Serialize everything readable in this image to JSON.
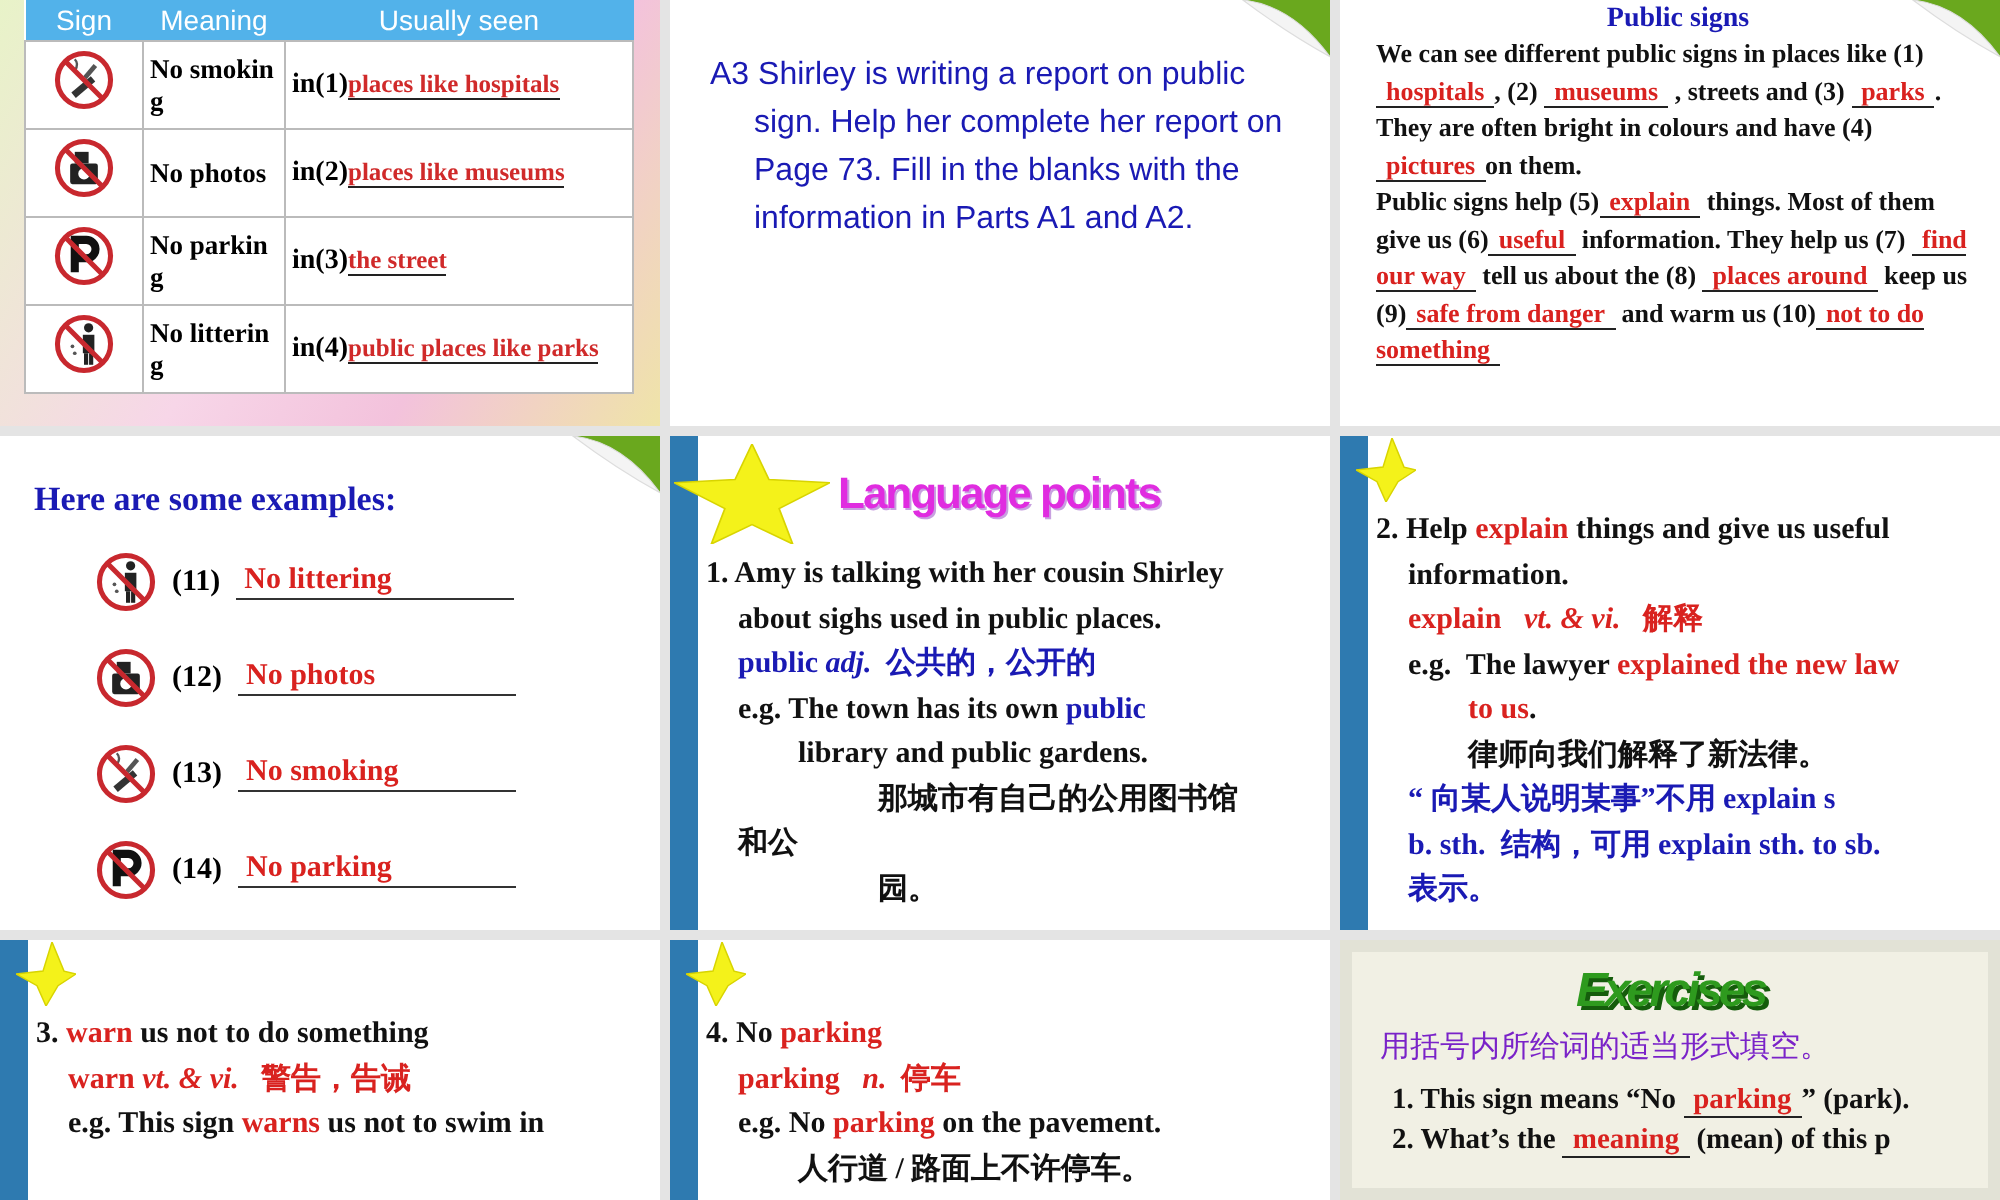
{
  "slides": [
    {
      "kind": "sign-table",
      "columns": [
        "Sign",
        "Meaning",
        "Usually seen"
      ],
      "rows": [
        {
          "kind": "smoking",
          "meaning": "No smoking",
          "number": "in(1)",
          "answer": "places like hospitals"
        },
        {
          "kind": "camera",
          "meaning": "No photos",
          "number": "in(2)",
          "answer": "places like museums"
        },
        {
          "kind": "parking",
          "meaning": "No parking",
          "number": "in(3)",
          "answer": "the street"
        },
        {
          "kind": "litter",
          "meaning": "No littering",
          "number": "in(4)",
          "answer": "public places like parks"
        }
      ]
    },
    {
      "kind": "text",
      "paragraph": "A3 Shirley is writing a report on public sign. Help her complete her report on Page 73. Fill in the blanks with the information in Parts A1 and A2."
    },
    {
      "kind": "report",
      "title": "Public signs",
      "paragraphs": [
        [
          {
            "text": "We can see different public signs in places like (1) ",
            "kind": "plain"
          },
          {
            "text": "hospitals",
            "kind": "blank"
          },
          {
            "text": ", (2) ",
            "kind": "plain"
          },
          {
            "text": "museums",
            "kind": "blank"
          },
          {
            "text": " , streets and (3) ",
            "kind": "plain"
          },
          {
            "text": "parks",
            "kind": "blank"
          },
          {
            "text": ". They are often bright in colours and have (4) ",
            "kind": "plain"
          },
          {
            "text": "pictures",
            "kind": "blank"
          },
          {
            "text": "on them.",
            "kind": "plain"
          }
        ],
        [
          {
            "text": "Public signs help (5)",
            "kind": "plain"
          },
          {
            "text": "explain",
            "kind": "blank"
          },
          {
            "text": " things. Most of them give us (6)",
            "kind": "plain"
          },
          {
            "text": "useful",
            "kind": "blank"
          },
          {
            "text": " information. They help us (7) ",
            "kind": "plain"
          },
          {
            "text": "find our way",
            "kind": "blank"
          },
          {
            "text": " tell us about the (8) ",
            "kind": "plain"
          },
          {
            "text": "places around",
            "kind": "blank"
          },
          {
            "text": " keep us (9)",
            "kind": "plain"
          },
          {
            "text": "safe from danger",
            "kind": "blank"
          },
          {
            "text": " and warm us (10)",
            "kind": "plain"
          },
          {
            "text": "not to do something",
            "kind": "blank"
          }
        ]
      ]
    },
    {
      "kind": "examples",
      "title": "Here are some examples:",
      "items": [
        {
          "kind": "litter",
          "number": "(11)",
          "answer": "No littering"
        },
        {
          "kind": "camera",
          "number": "(12)",
          "answer": "No photos"
        },
        {
          "kind": "smoking",
          "number": "(13)",
          "answer": "No smoking"
        },
        {
          "kind": "parking",
          "number": "(14)",
          "answer": "No parking"
        }
      ]
    },
    {
      "kind": "notes",
      "title": "Language points",
      "lines": [
        {
          "kind": "head",
          "runs": [
            {
              "text": "1. Amy is talking with her cousin Shirley",
              "kind": "plain"
            }
          ]
        },
        {
          "kind": "body",
          "runs": [
            {
              "text": "about sighs used in public places.",
              "kind": "plain"
            }
          ]
        },
        {
          "kind": "body",
          "runs": [
            {
              "text": "public ",
              "kind": "blue"
            },
            {
              "text": "adj.",
              "kind": "blue-italic"
            },
            {
              "text": "  公共的，公开的",
              "kind": "blue"
            }
          ]
        },
        {
          "kind": "body",
          "runs": [
            {
              "text": "e.g. The town has its own ",
              "kind": "plain"
            },
            {
              "text": "public",
              "kind": "blue"
            }
          ]
        },
        {
          "kind": "sub",
          "runs": [
            {
              "text": "library and public gardens.",
              "kind": "plain"
            }
          ]
        },
        {
          "kind": "far",
          "runs": [
            {
              "text": "那城市有自己的公用图书馆",
              "kind": "plain"
            }
          ]
        },
        {
          "kind": "body",
          "runs": [
            {
              "text": "和公",
              "kind": "plain"
            }
          ]
        },
        {
          "kind": "far",
          "runs": [
            {
              "text": "园。",
              "kind": "plain"
            }
          ]
        }
      ]
    },
    {
      "kind": "notes",
      "lines": [
        {
          "kind": "head",
          "runs": [
            {
              "text": "2. Help ",
              "kind": "plain"
            },
            {
              "text": "explain",
              "kind": "red"
            },
            {
              "text": " things and give us useful",
              "kind": "plain"
            }
          ]
        },
        {
          "kind": "body",
          "runs": [
            {
              "text": "information.",
              "kind": "plain"
            }
          ]
        },
        {
          "kind": "body",
          "runs": [
            {
              "text": "explain   ",
              "kind": "red"
            },
            {
              "text": "vt. & vi.",
              "kind": "red-italic"
            },
            {
              "text": "   解释",
              "kind": "red"
            }
          ]
        },
        {
          "kind": "body",
          "runs": [
            {
              "text": "e.g.  The lawyer ",
              "kind": "plain"
            },
            {
              "text": "explained the new law",
              "kind": "red"
            }
          ]
        },
        {
          "kind": "sub",
          "runs": [
            {
              "text": "to us",
              "kind": "red"
            },
            {
              "text": ".",
              "kind": "plain"
            }
          ]
        },
        {
          "kind": "sub",
          "runs": [
            {
              "text": "律师向我们解释了新法律。",
              "kind": "plain"
            }
          ]
        },
        {
          "kind": "body",
          "runs": [
            {
              "text": "“ 向某人说明某事”不用 explain s",
              "kind": "blue"
            }
          ]
        },
        {
          "kind": "body",
          "runs": [
            {
              "text": "b. sth.  结构，可用 explain sth. to sb.",
              "kind": "blue"
            }
          ]
        },
        {
          "kind": "body",
          "runs": [
            {
              "text": "表示。",
              "kind": "blue"
            }
          ]
        }
      ]
    },
    {
      "kind": "notes",
      "lines": [
        {
          "kind": "head",
          "runs": [
            {
              "text": "3. ",
              "kind": "plain"
            },
            {
              "text": "warn",
              "kind": "red"
            },
            {
              "text": " us not to do something",
              "kind": "plain"
            }
          ]
        },
        {
          "kind": "body",
          "runs": [
            {
              "text": "warn ",
              "kind": "red"
            },
            {
              "text": "vt. & vi.",
              "kind": "red-italic"
            },
            {
              "text": "   警告，告诫",
              "kind": "red"
            }
          ]
        },
        {
          "kind": "body",
          "runs": [
            {
              "text": "e.g. This sign ",
              "kind": "plain"
            },
            {
              "text": "warns",
              "kind": "red"
            },
            {
              "text": " us not to swim in",
              "kind": "plain"
            }
          ]
        }
      ]
    },
    {
      "kind": "notes",
      "lines": [
        {
          "kind": "head",
          "runs": [
            {
              "text": "4. No ",
              "kind": "plain"
            },
            {
              "text": "parking",
              "kind": "red"
            }
          ]
        },
        {
          "kind": "body",
          "runs": [
            {
              "text": "parking   ",
              "kind": "red"
            },
            {
              "text": "n.",
              "kind": "red-italic"
            },
            {
              "text": "  停车",
              "kind": "red"
            }
          ]
        },
        {
          "kind": "body",
          "runs": [
            {
              "text": "e.g. No ",
              "kind": "plain"
            },
            {
              "text": "parking",
              "kind": "red"
            },
            {
              "text": " on the pavement.",
              "kind": "plain"
            }
          ]
        },
        {
          "kind": "sub",
          "runs": [
            {
              "text": "人行道 / 路面上不许停车。",
              "kind": "plain"
            }
          ]
        }
      ]
    },
    {
      "kind": "exercise",
      "title": "Exercises",
      "instruction": "用括号内所给词的适当形式填空。",
      "lines": [
        {
          "kind": "head",
          "runs": [
            {
              "text": "1. This sign means “No ",
              "kind": "plain"
            },
            {
              "text": "parking",
              "kind": "blank"
            },
            {
              "text": "” (park).",
              "kind": "plain"
            }
          ]
        },
        {
          "kind": "head",
          "runs": [
            {
              "text": "2. What’s the ",
              "kind": "plain"
            },
            {
              "text": "meaning",
              "kind": "blank"
            },
            {
              "text": " (mean) of this p",
              "kind": "plain"
            }
          ]
        }
      ]
    }
  ]
}
